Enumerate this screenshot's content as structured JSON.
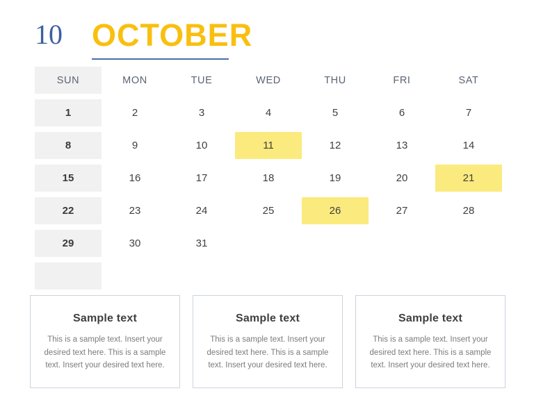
{
  "header": {
    "month_number": "10",
    "month_name": "OCTOBER",
    "number_color": "#3d5fa0",
    "name_color": "#f9bf10",
    "underline_color": "#4a6da7"
  },
  "calendar": {
    "day_headers": [
      "SUN",
      "MON",
      "TUE",
      "WED",
      "THU",
      "FRI",
      "SAT"
    ],
    "sunday_band_color": "#f1f1f1",
    "highlight_color": "#fbea7e",
    "weeks": [
      [
        "1",
        "2",
        "3",
        "4",
        "5",
        "6",
        "7"
      ],
      [
        "8",
        "9",
        "10",
        "11",
        "12",
        "13",
        "14"
      ],
      [
        "15",
        "16",
        "17",
        "18",
        "19",
        "20",
        "21"
      ],
      [
        "22",
        "23",
        "24",
        "25",
        "26",
        "27",
        "28"
      ],
      [
        "29",
        "30",
        "31",
        "",
        "",
        "",
        ""
      ],
      [
        "",
        "",
        "",
        "",
        "",
        "",
        ""
      ]
    ],
    "highlighted_dates": [
      "11",
      "21",
      "26"
    ]
  },
  "boxes": [
    {
      "title": "Sample text",
      "body": "This is a sample text. Insert your desired text here. This is a sample text. Insert your desired text here."
    },
    {
      "title": "Sample text",
      "body": "This is a sample text. Insert your desired text here. This is a sample text. Insert your desired text here."
    },
    {
      "title": "Sample text",
      "body": "This is a sample text. Insert your desired text here. This is a sample text. Insert your desired text here."
    }
  ]
}
